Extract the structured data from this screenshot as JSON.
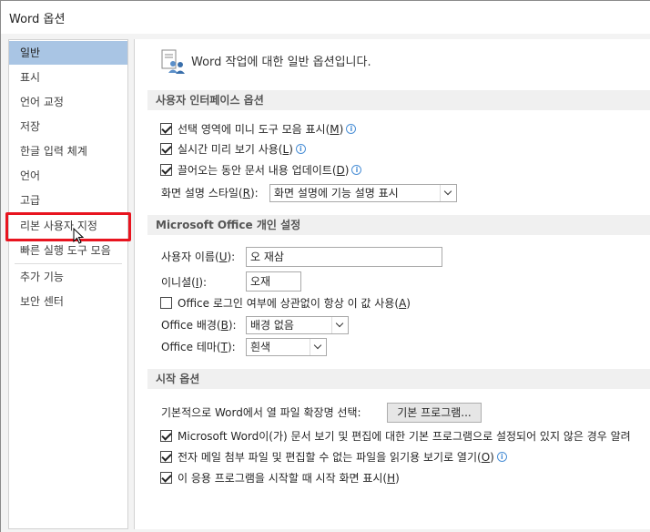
{
  "window": {
    "title": "Word 옵션"
  },
  "sidebar": {
    "items": [
      {
        "label": "일반"
      },
      {
        "label": "표시"
      },
      {
        "label": "언어 교정"
      },
      {
        "label": "저장"
      },
      {
        "label": "한글 입력 체계"
      },
      {
        "label": "언어"
      },
      {
        "label": "고급"
      },
      {
        "label": "리본 사용자 지정"
      },
      {
        "label": "빠른 실행 도구 모음"
      },
      {
        "label": "추가 기능"
      },
      {
        "label": "보안 센터"
      }
    ],
    "selected": "일반",
    "highlighted": "리본 사용자 지정"
  },
  "main": {
    "intro": "Word 작업에 대한 일반 옵션입니다.",
    "ui_section": {
      "header": "사용자 인터페이스 옵션",
      "mini_toolbar": {
        "label": "선택 영역에 미니 도구 모음 표시(",
        "key": "M",
        "tail": ")",
        "checked": true
      },
      "live_preview": {
        "label": "실시간 미리 보기 사용(",
        "key": "L",
        "tail": ")",
        "checked": true
      },
      "update_drag": {
        "label": "끌어오는 동안 문서 내용 업데이트(",
        "key": "D",
        "tail": ")",
        "checked": true
      },
      "screentip": {
        "label": "화면 설명 스타일(",
        "key": "R",
        "tail": "):",
        "value": "화면 설명에 기능 설명 표시"
      }
    },
    "personal_section": {
      "header": "Microsoft Office 개인 설정",
      "username": {
        "label": "사용자 이름(",
        "key": "U",
        "tail": "):",
        "value": "오 재삼"
      },
      "initials": {
        "label": "이니셜(",
        "key": "I",
        "tail": "):",
        "value": "오재"
      },
      "always_use": {
        "label": "Office 로그인 여부에 상관없이 항상 이 값 사용(",
        "key": "A",
        "tail": ")",
        "checked": false
      },
      "background": {
        "label": "Office 배경(",
        "key": "B",
        "tail": "):",
        "value": "배경 없음"
      },
      "theme": {
        "label": "Office 테마(",
        "key": "T",
        "tail": "):",
        "value": "흰색"
      }
    },
    "startup_section": {
      "header": "시작 옵션",
      "default_ext": {
        "label": "기본적으로 Word에서 열 파일 확장명 선택:",
        "button": "기본 프로그램..."
      },
      "tell_me": {
        "label": "Microsoft Word이(가) 문서 보기 및 편집에 대한 기본 프로그램으로 설정되어 있지 않은 경우 알려",
        "checked": true
      },
      "reading_view": {
        "label": "전자 메일 첨부 파일 및 편집할 수 없는 파일을 읽기용 보기로 열기(",
        "key": "O",
        "tail": ")",
        "checked": true
      },
      "start_screen": {
        "label": "이 응용 프로그램을 시작할 때 시작 화면 표시(",
        "key": "H",
        "tail": ")",
        "checked": true
      }
    }
  },
  "colors": {
    "selected_nav": "#a9c5e4",
    "highlight_box": "#e8141f",
    "section_header_bg": "#f0f0f0",
    "info_icon": "#4a8fd6"
  }
}
